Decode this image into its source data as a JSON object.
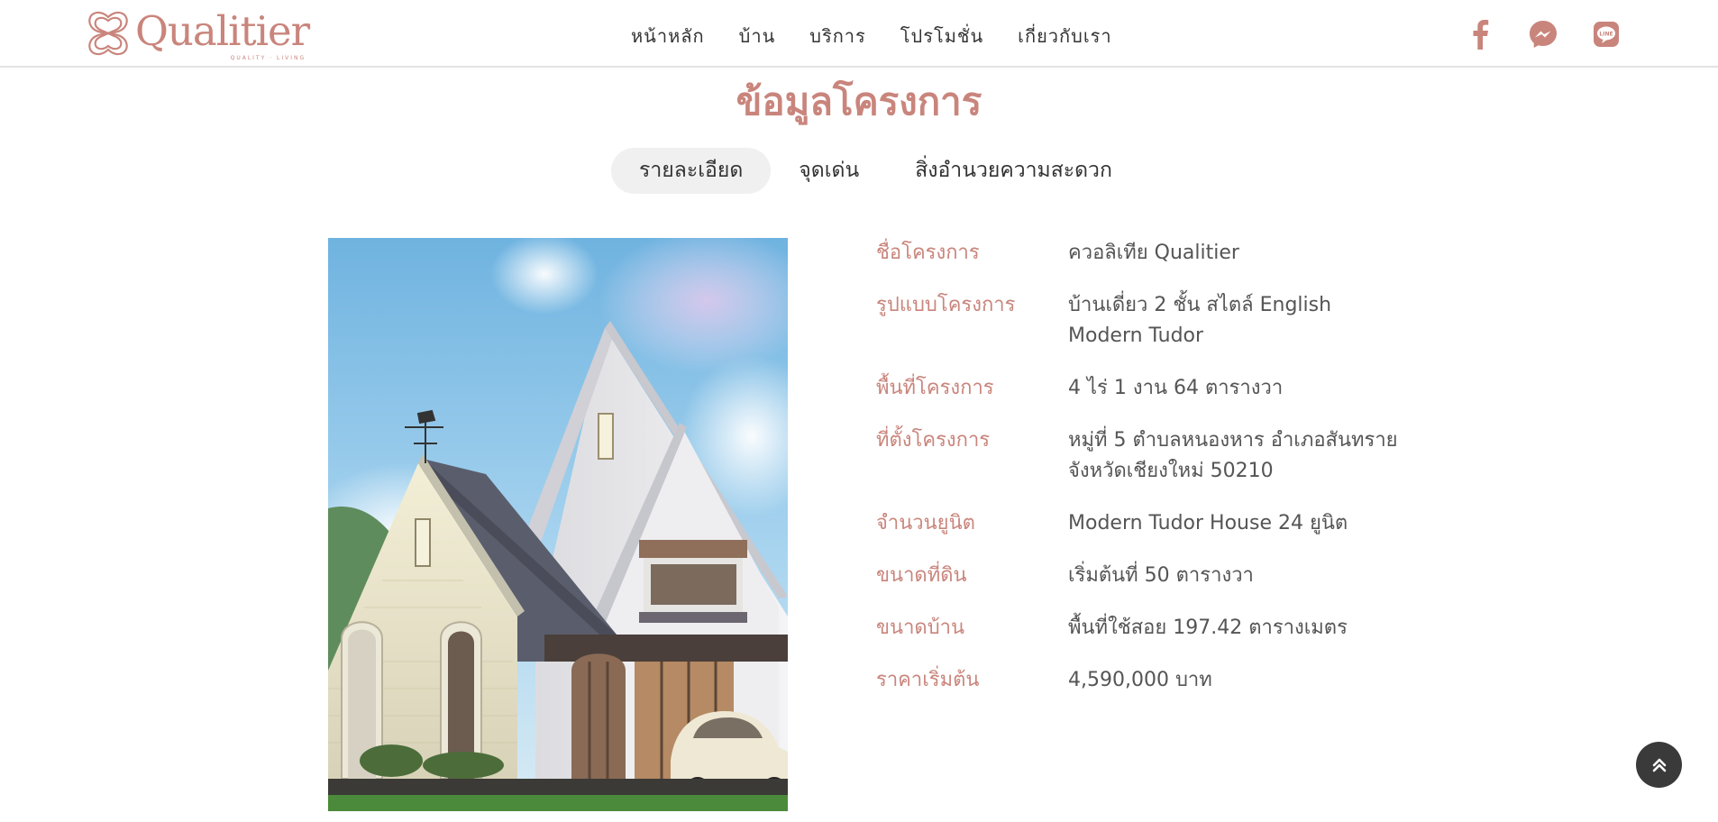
{
  "brand": {
    "name": "Qualitier",
    "tagline": "QUALITY · LIVING",
    "color": "#c9857c"
  },
  "nav": {
    "items": [
      {
        "label": "หน้าหลัก"
      },
      {
        "label": "บ้าน"
      },
      {
        "label": "บริการ"
      },
      {
        "label": "โปรโมชั่น"
      },
      {
        "label": "เกี่ยวกับเรา"
      }
    ]
  },
  "social": {
    "icons": [
      "facebook-icon",
      "messenger-icon",
      "line-icon"
    ],
    "line_text": "LINE"
  },
  "section": {
    "title": "ข้อมูลโครงการ"
  },
  "tabs": [
    {
      "label": "รายละเอียด",
      "active": true
    },
    {
      "label": "จุดเด่น",
      "active": false
    },
    {
      "label": "สิ่งอำนวยความสะดวก",
      "active": false
    }
  ],
  "details": [
    {
      "label": "ชื่อโครงการ",
      "value": "ควอลิเทีย Qualitier"
    },
    {
      "label": "รูปแบบโครงการ",
      "value": "บ้านเดี่ยว 2 ชั้น สไตล์ English Modern Tudor"
    },
    {
      "label": "พื้นที่โครงการ",
      "value": "4 ไร่ 1 งาน 64 ตารางวา"
    },
    {
      "label": "ที่ตั้งโครงการ",
      "value": "หมู่ที่ 5 ตำบลหนองหาร อำเภอสันทราย จังหวัดเชียงใหม่ 50210"
    },
    {
      "label": "จำนวนยูนิต",
      "value": "Modern Tudor House 24 ยูนิต"
    },
    {
      "label": "ขนาดที่ดิน",
      "value": "เริ่มต้นที่ 50 ตารางวา"
    },
    {
      "label": "ขนาดบ้าน",
      "value": "พื้นที่ใช้สอย 197.42 ตารางเมตร"
    },
    {
      "label": "ราคาเริ่มต้น",
      "value": "4,590,000 บาท"
    }
  ],
  "colors": {
    "accent": "#c9857c",
    "text": "#555555",
    "nav_text": "#333333",
    "tab_active_bg": "#f0f0f0",
    "to_top_bg": "#3a3a3a"
  }
}
